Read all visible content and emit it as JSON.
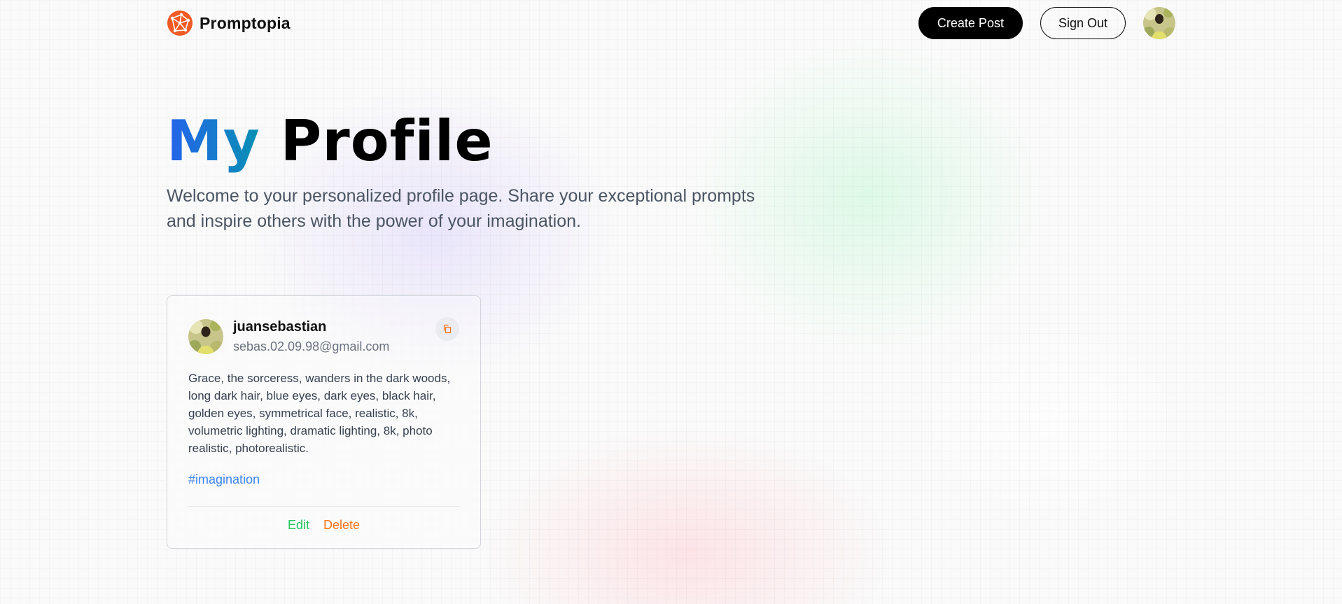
{
  "nav": {
    "brand_name": "Promptopia",
    "create_post_label": "Create Post",
    "sign_out_label": "Sign Out"
  },
  "header": {
    "title_accent": "My",
    "title_rest": "Profile",
    "description": "Welcome to your personalized profile page. Share your exceptional prompts and inspire others with the power of your imagination."
  },
  "prompt_card": {
    "username": "juansebastian",
    "email": "sebas.02.09.98@gmail.com",
    "prompt": "Grace, the sorceress, wanders in the dark woods, long dark hair, blue eyes, dark eyes, black hair, golden eyes, symmetrical face, realistic, 8k, volumetric lighting, dramatic lighting, 8k, photo realistic, photorealistic.",
    "tag": "#imagination",
    "edit_label": "Edit",
    "delete_label": "Delete"
  },
  "icons": {
    "logo": "promptopia-logo-icon",
    "copy": "copy-icon"
  },
  "colors": {
    "title_gradient_start": "#2563eb",
    "title_gradient_end": "#0891b2",
    "logo": "#f05a24",
    "tag": "#3b82f6",
    "edit": "#22c55e",
    "delete": "#f97316"
  }
}
